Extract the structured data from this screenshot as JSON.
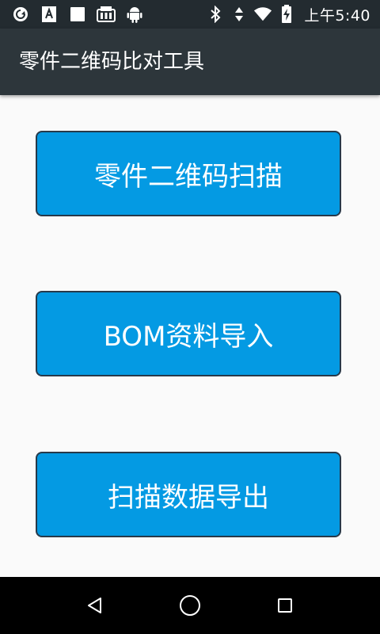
{
  "status_bar": {
    "time": "上午5:40",
    "left_icons": [
      "sync-icon",
      "font-app-icon",
      "blank-square-icon",
      "sim-card-icon",
      "android-icon"
    ],
    "right_icons": [
      "bluetooth-icon",
      "data-arrows-icon",
      "wifi-icon",
      "battery-charging-icon"
    ]
  },
  "app_bar": {
    "title": "零件二维码比对工具"
  },
  "buttons": {
    "scan": "零件二维码扫描",
    "bom_import": "BOM资料导入",
    "export": "扫描数据导出"
  },
  "colors": {
    "status_bar_bg": "#232b30",
    "app_bar_bg": "#2d363b",
    "button_bg": "#049ae3",
    "button_border": "#27394a",
    "content_bg": "#fafafa",
    "nav_bar_bg": "#000000"
  },
  "nav_bar": {
    "icons": [
      "back-icon",
      "home-icon",
      "recent-apps-icon"
    ]
  }
}
